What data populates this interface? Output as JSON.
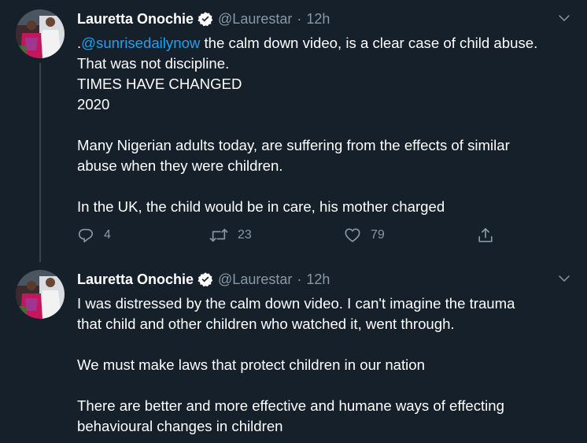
{
  "tweets": [
    {
      "author": {
        "name": "Lauretta Onochie",
        "handle": "@Laurestar",
        "verified": true,
        "avatar_icon": "profile-photo"
      },
      "separator": "·",
      "time": "12h",
      "mention": "@sunrisedailynow",
      "lines": [
        {
          "prefix": ".",
          "text": " the calm down video, is a clear case of child abuse."
        },
        {
          "text": "That was not discipline."
        },
        {
          "text": "TIMES HAVE CHANGED"
        },
        {
          "text": "2020"
        },
        {
          "text": ""
        },
        {
          "text": "Many Nigerian adults today, are suffering from the effects of similar"
        },
        {
          "text": "abuse when they were children."
        },
        {
          "text": ""
        },
        {
          "text": "In the UK, the child would be in care, his mother charged"
        }
      ],
      "actions": {
        "reply_count": "4",
        "retweet_count": "23",
        "like_count": "79"
      }
    },
    {
      "author": {
        "name": "Lauretta Onochie",
        "handle": "@Laurestar",
        "verified": true,
        "avatar_icon": "profile-photo"
      },
      "separator": "·",
      "time": "12h",
      "lines": [
        {
          "text": "I was distressed by the calm down video. I can't imagine the trauma"
        },
        {
          "text": "that child and other children who watched it, went through."
        },
        {
          "text": ""
        },
        {
          "text": "We must make laws that protect children in our nation"
        },
        {
          "text": ""
        },
        {
          "text": "There are better and more effective and humane ways of effecting"
        },
        {
          "text": "behavioural changes in children"
        }
      ]
    }
  ],
  "colors": {
    "background": "#15202b",
    "text": "#ffffff",
    "secondary": "#8899a6",
    "link": "#1da1f2",
    "thread_line": "#38444d"
  }
}
